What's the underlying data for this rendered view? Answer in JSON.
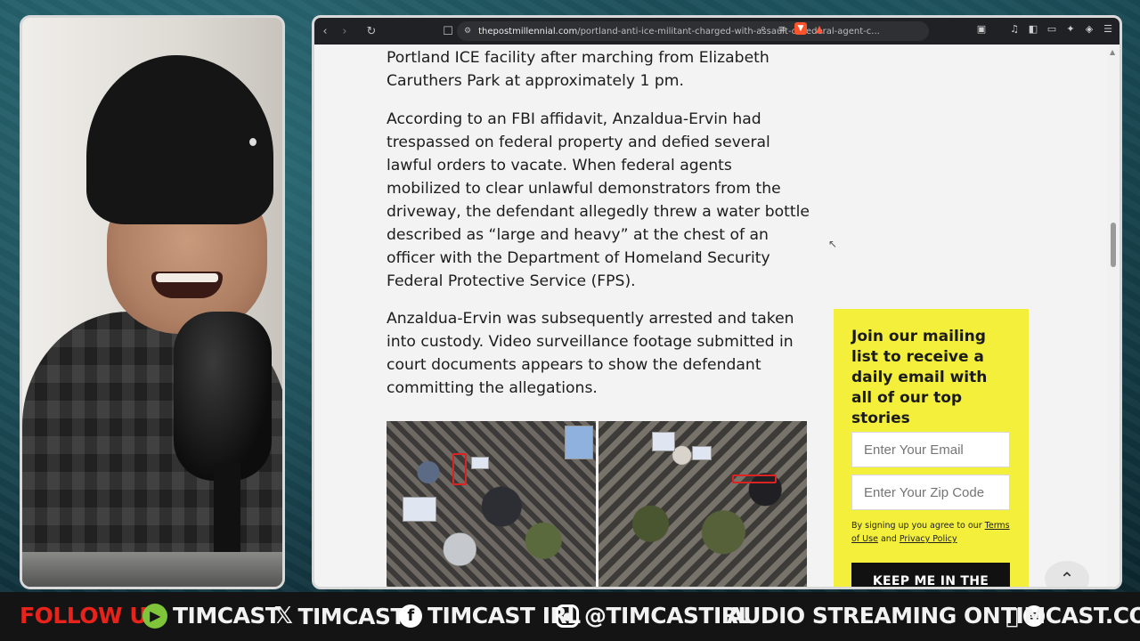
{
  "browser": {
    "url_host": "thepostmillennial.com",
    "url_path": "/portland-anti-ice-militant-charged-with-assault-of-federal-agent-c...",
    "icons": [
      "back-icon",
      "forward-icon",
      "reload-icon",
      "bookmark-icon",
      "site-settings-icon",
      "zoom-icon",
      "reader-icon",
      "brave-shields-icon",
      "brave-rewards-icon",
      "media-icon",
      "sidebar-icon",
      "wallet-icon",
      "leo-icon",
      "vpn-icon",
      "menu-icon"
    ]
  },
  "article": {
    "paragraphs": [
      "Portland ICE facility after marching from Elizabeth Caruthers Park at approximately 1 pm.",
      "According to an FBI affidavit, Anzaldua-Ervin had trespassed on federal property and defied several lawful orders to vacate. When federal agents mobilized to clear unlawful demonstrators from the driveway, the defendant allegedly threw a water bottle described as “large and heavy” at the chest of an officer with the Department of Homeland Security Federal Protective Service (FPS).",
      "Anzaldua-Ervin was subsequently arrested and taken into custody. Video surveillance footage submitted in court documents appears to show the defendant committing the allegations."
    ]
  },
  "newsletter": {
    "heading": "Join our mailing list to receive a daily email with all of our top stories",
    "email_placeholder": "Enter Your Email",
    "zip_placeholder": "Enter Your Zip Code",
    "terms_prefix": "By signing up you agree to our",
    "terms_link": "Terms of Use",
    "terms_and": "and",
    "privacy_link": "Privacy Policy",
    "button_label": "KEEP ME IN THE"
  },
  "bottom_bar": {
    "follow": "FOLLOW US",
    "rumble": "TIMCAST",
    "x": "TIMCAST",
    "facebook": "TIMCAST IRL",
    "instagram": "@TIMCASTIRL",
    "audio": "AUDIO STREAMING ON",
    "site": "TIMCAST.COM"
  },
  "colors": {
    "follow_red": "#e8231c",
    "newsletter_yellow": "#f3ef3a",
    "rumble_green": "#7ec53a"
  }
}
